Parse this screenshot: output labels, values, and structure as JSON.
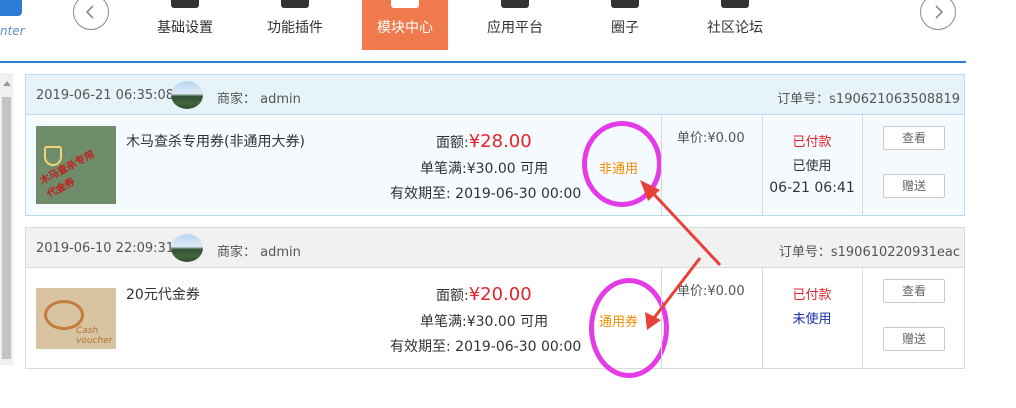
{
  "brand": {
    "text": "nter",
    "color": "#2b7cd3"
  },
  "nav": {
    "items": [
      {
        "label": "基础设置",
        "icon": "windows-icon"
      },
      {
        "label": "功能插件",
        "icon": "plugin-icon"
      },
      {
        "label": "模块中心",
        "icon": "module-icon",
        "active": true
      },
      {
        "label": "应用平台",
        "icon": "app-icon"
      },
      {
        "label": "圈子",
        "icon": "twitter-icon"
      },
      {
        "label": "社区论坛",
        "icon": "forum-icon"
      }
    ],
    "active_color": "#f07a4d",
    "accent_color": "#2b7cd3"
  },
  "orders": [
    {
      "time": "2019-06-21 06:35:08",
      "merchant": "商家： admin",
      "order_no": "订单号：s190621063508819",
      "coupon": {
        "name": "木马查杀专用券(非通用大券)",
        "face_label": "面额:",
        "face_amount": "¥28.00",
        "min_spend": "单笔满:¥30.00 可用",
        "valid_until": "有效期至: 2019-06-30 00:00",
        "tag": "非通用",
        "image_text": "木马查杀专用代金券"
      },
      "unit_price": "单价:¥0.00",
      "pay_status": "已付款",
      "use_status": "已使用",
      "use_time": "06-21 06:41",
      "view_label": "查看",
      "gift_label": "赠送"
    },
    {
      "time": "2019-06-10 22:09:31",
      "merchant": "商家： admin",
      "order_no": "订单号：s190610220931eac",
      "coupon": {
        "name": "20元代金券",
        "face_label": "面额:",
        "face_amount": "¥20.00",
        "min_spend": "单笔满:¥30.00 可用",
        "valid_until": "有效期至: 2019-06-30 00:00",
        "tag": "通用券",
        "image_text": "Cash voucher"
      },
      "unit_price": "单价:¥0.00",
      "pay_status": "已付款",
      "use_status": "未使用",
      "use_time": "",
      "view_label": "查看",
      "gift_label": "赠送"
    }
  ],
  "colors": {
    "price": "#e4242a",
    "tag": "#f08c00",
    "annotation_ring": "#e53be6",
    "annotation_arrow": "#e8413a",
    "unused": "#1a2fa8"
  }
}
